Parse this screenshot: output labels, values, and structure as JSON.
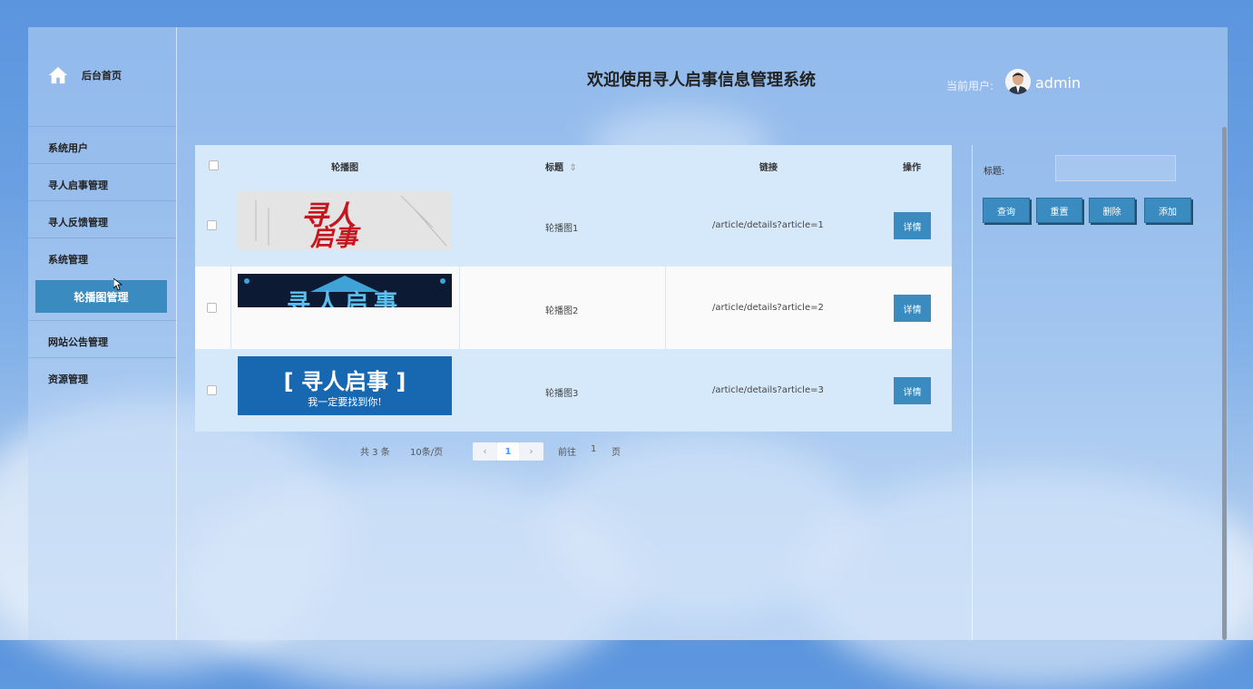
{
  "colors": {
    "accent": "#3a8bbf",
    "header_bg": "#d6e9fb"
  },
  "sidebar": {
    "home_label": "后台首页",
    "items": [
      {
        "label": "系统用户"
      },
      {
        "label": "寻人启事管理"
      },
      {
        "label": "寻人反馈管理"
      },
      {
        "label": "系统管理"
      },
      {
        "label": "轮播图管理"
      },
      {
        "label": "网站公告管理"
      },
      {
        "label": "资源管理"
      }
    ]
  },
  "header": {
    "title": "欢迎使用寻人启事信息管理系统",
    "user_label": "当前用户:",
    "user_name": "admin"
  },
  "table": {
    "columns": [
      "轮播图",
      "标题",
      "链接",
      "操作"
    ],
    "sort_icon": "⇕",
    "rows": [
      {
        "title": "轮播图1",
        "link": "/article/details?article=1",
        "action": "详情",
        "image": {
          "line1": "寻人",
          "line2": "启事"
        }
      },
      {
        "title": "轮播图2",
        "link": "/article/details?article=2",
        "action": "详情",
        "image": {
          "text": "寻人启事"
        }
      },
      {
        "title": "轮播图3",
        "link": "/article/details?article=3",
        "action": "详情",
        "image": {
          "line1": "[ 寻人启事 ]",
          "line2": "我一定要找到你!"
        }
      }
    ]
  },
  "pagination": {
    "total": "共 3 条",
    "page_size": "10条/页",
    "current": "1",
    "goto_label": "前往",
    "goto_value": "1",
    "page_unit": "页"
  },
  "search": {
    "label": "标题:",
    "placeholder": "",
    "buttons": {
      "query": "查询",
      "reset": "重置",
      "delete": "删除",
      "add": "添加"
    }
  }
}
